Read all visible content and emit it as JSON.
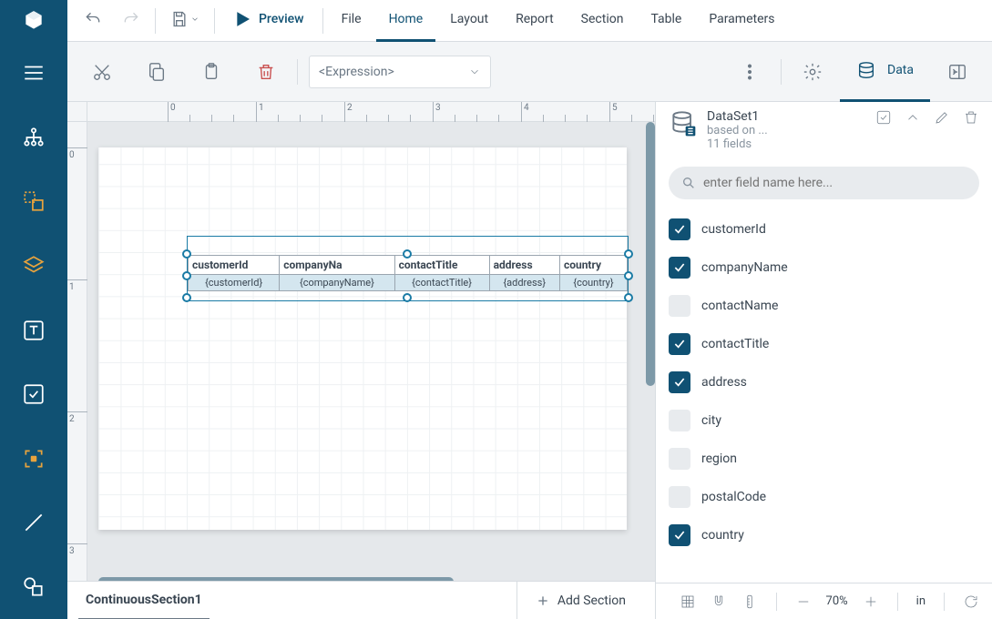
{
  "top": {
    "preview": "Preview",
    "menus": [
      "File",
      "Home",
      "Layout",
      "Report",
      "Section",
      "Table",
      "Parameters"
    ],
    "active_menu": 1
  },
  "toolbar": {
    "expression": "<Expression>",
    "data_label": "Data"
  },
  "ruler_h": [
    "0",
    "1",
    "2",
    "3",
    "4",
    "5"
  ],
  "ruler_v": [
    "0",
    "1",
    "2",
    "3"
  ],
  "table": {
    "headers": [
      "customerId",
      "companyNa",
      "contactTitle",
      "address",
      "country"
    ],
    "cells": [
      "{customerId}",
      "{companyName}",
      "{contactTitle}",
      "{address}",
      "{country}"
    ]
  },
  "section_tab": "ContinuousSection1",
  "add_section": "Add Section",
  "dataset": {
    "name": "DataSet1",
    "based": "based on ...",
    "count": "11 fields",
    "search_ph": "enter field name here...",
    "fields": [
      {
        "name": "customerId",
        "on": true
      },
      {
        "name": "companyName",
        "on": true
      },
      {
        "name": "contactName",
        "on": false
      },
      {
        "name": "contactTitle",
        "on": true
      },
      {
        "name": "address",
        "on": true
      },
      {
        "name": "city",
        "on": false
      },
      {
        "name": "region",
        "on": false
      },
      {
        "name": "postalCode",
        "on": false
      },
      {
        "name": "country",
        "on": true
      }
    ]
  },
  "zoom": {
    "pct": "70%",
    "unit": "in"
  }
}
